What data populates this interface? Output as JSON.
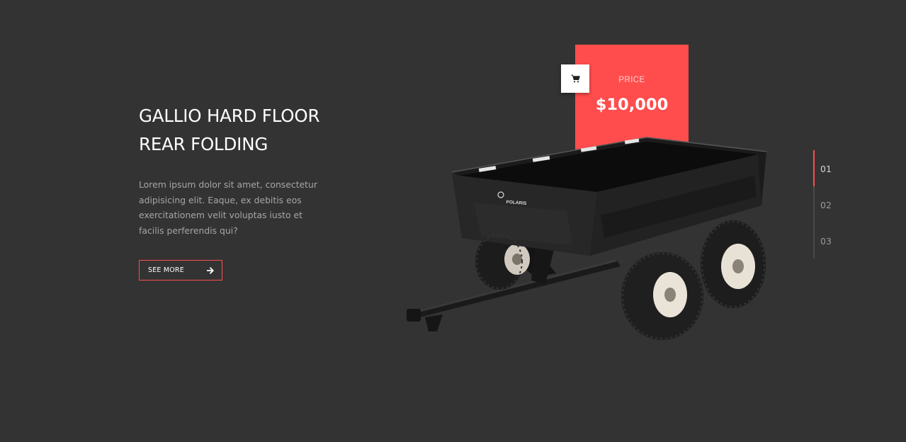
{
  "hero": {
    "title_line1": "GALLIO HARD FLOOR",
    "title_line2": "REAR FOLDING",
    "description": "Lorem ipsum dolor sit amet, consectetur adipisicing elit. Eaque, ex debitis eos exercitationem velit voluptas iusto et facilis perferendis qui?",
    "button_label": "SEE MORE"
  },
  "price": {
    "label": "PRICE",
    "value": "$10,000"
  },
  "product": {
    "brand": "POLARIS"
  },
  "slides": {
    "items": [
      "01",
      "02",
      "03"
    ],
    "active": "01"
  },
  "colors": {
    "background": "#333333",
    "accent": "#ff4d4d",
    "text": "#ffffff",
    "muted": "#a6a6a6"
  },
  "icons": {
    "cart": "shopping-cart-icon",
    "arrow": "arrow-right-icon"
  }
}
